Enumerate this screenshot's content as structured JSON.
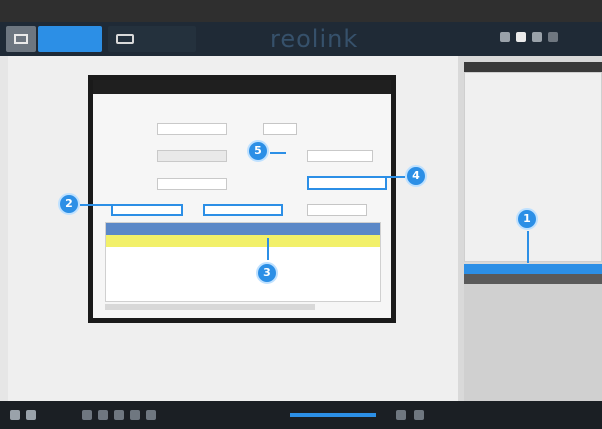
{
  "topbar": {
    "left_text": "",
    "center_text": "",
    "right_text": ""
  },
  "nav": {
    "brand": "reolink",
    "tabs": [
      {
        "label": ""
      },
      {
        "label": ""
      }
    ]
  },
  "dialog": {
    "title": "",
    "section_title": "",
    "rows": [
      {
        "label": "",
        "value": ""
      },
      {
        "label": "",
        "value": ""
      },
      {
        "label": "",
        "value": ""
      }
    ],
    "right_labels": [
      "",
      "",
      ""
    ],
    "buttons": [
      {
        "label": ""
      },
      {
        "label": ""
      },
      {
        "label": ""
      }
    ],
    "table": {
      "headers": [
        "",
        "",
        "",
        ""
      ],
      "rows": [
        {
          "cells": [
            "",
            "",
            "",
            ""
          ]
        }
      ]
    }
  },
  "callouts": [
    "1",
    "2",
    "3",
    "4",
    "5"
  ],
  "colors": {
    "accent": "#2c8fe6",
    "highlight_row": "#f2f06a",
    "nav_bg": "#1f2a36"
  }
}
